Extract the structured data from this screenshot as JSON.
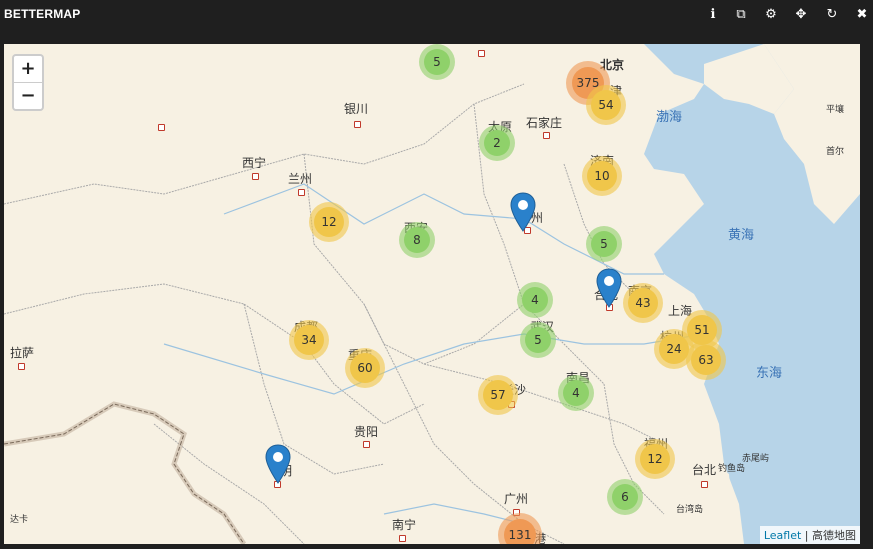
{
  "panel": {
    "title": "BETTERMAP",
    "icons": [
      "info-icon",
      "duplicate-icon",
      "gear-icon",
      "move-icon",
      "refresh-icon",
      "close-icon"
    ],
    "icon_glyphs": [
      "ℹ",
      "⧉",
      "⚙",
      "✥",
      "↻",
      "✖"
    ]
  },
  "zoom": {
    "in_label": "+",
    "out_label": "−"
  },
  "colors": {
    "cluster_small": "#8fd16a",
    "cluster_medium": "#f0c64a",
    "cluster_large": "#ef9955",
    "sea": "#b7d4e8",
    "land": "#f7f1e3",
    "marker": "#2a81cb"
  },
  "labels": {
    "beijing": "北京",
    "tianjin": "津",
    "bohai": "渤海",
    "taiyuan": "太原",
    "shijiazhuang": "石家庄",
    "yinchuan": "银川",
    "xining": "西宁",
    "lanzhou": "兰州",
    "jinan": "济南",
    "xian": "西安",
    "zhengzhou": "州",
    "huanghai": "黄海",
    "nanjing": "南京",
    "hefei": "合肥",
    "shanghai": "上海",
    "chengdu": "成都",
    "wuhan": "武汉",
    "hangzhou": "杭州",
    "donghai": "东海",
    "lhasa": "拉萨",
    "chongqing": "重庆",
    "changsha": "长沙",
    "nanchang": "南昌",
    "guiyang": "贵阳",
    "fuzhou": "福州",
    "taibei": "台北",
    "chiweiyu": "赤尾屿",
    "diaoyudao": "钓鱼岛",
    "taiwandao": "台湾岛",
    "kunming": "明",
    "guangzhou": "广州",
    "xianggang": "香港",
    "nanning": "南宁",
    "daka": "达卡",
    "pingrang": "平壤",
    "shouer": "首尔"
  },
  "clusters": [
    "5",
    "375",
    "54",
    "2",
    "10",
    "12",
    "8",
    "5",
    "4",
    "43",
    "51",
    "34",
    "5",
    "24",
    "63",
    "60",
    "57",
    "4",
    "12",
    "6",
    "131"
  ],
  "attribution": {
    "link": "Leaflet",
    "separator": " | ",
    "text": "高德地图"
  }
}
